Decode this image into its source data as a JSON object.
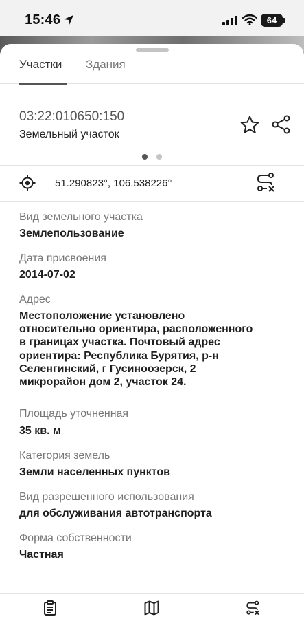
{
  "status": {
    "time": "15:46",
    "battery": "64"
  },
  "tabs": [
    {
      "label": "Участки",
      "active": true
    },
    {
      "label": "Здания",
      "active": false
    }
  ],
  "parcel": {
    "id": "03:22:010650:150",
    "type": "Земельный участок"
  },
  "coordinates": "51.290823°, 106.538226°",
  "pager": {
    "count": 2,
    "active": 0
  },
  "fields": [
    {
      "label": "Вид земельного участка",
      "value": "Землепользование"
    },
    {
      "label": "Дата присвоения",
      "value": "2014-07-02"
    },
    {
      "label": "Адрес",
      "value_lines": [
        "Местоположение установлено",
        "относительно ориентира, расположенного",
        "в границах участка. Почтовый адрес",
        "ориентира: Республика Бурятия, р-н",
        "Селенгинский, г Гусиноозерск, 2",
        "микрорайон дом 2, участок 24."
      ]
    },
    {
      "label": "Площадь уточненная",
      "value": "35 кв. м"
    },
    {
      "label": "Категория земель",
      "value": "Земли населенных пунктов"
    },
    {
      "label": "Вид разрешенного использования",
      "value": "для обслуживания автотранспорта"
    },
    {
      "label": "Форма собственности",
      "value": "Частная"
    }
  ],
  "icons": {
    "favorite": "star-icon",
    "share": "share-icon",
    "locate": "crosshair-icon",
    "route": "route-cancel-icon",
    "nav_info": "clipboard-icon",
    "nav_map": "map-icon",
    "nav_route": "route-cancel-icon"
  },
  "colors": {
    "accent": "#555555",
    "text": "#1f1f1f",
    "muted": "#777777"
  }
}
